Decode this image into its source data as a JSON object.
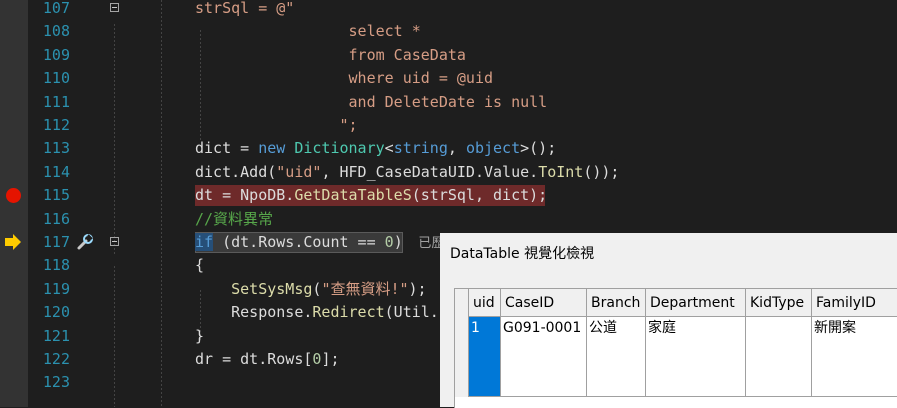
{
  "editor": {
    "lines": [
      {
        "num": "107",
        "tokens": [
          [
            "strSql = @\"",
            "s"
          ]
        ],
        "fold": true
      },
      {
        "num": "108",
        "tokens": [
          [
            "                 select *",
            "s"
          ]
        ]
      },
      {
        "num": "109",
        "tokens": [
          [
            "                 from CaseData",
            "s"
          ]
        ]
      },
      {
        "num": "110",
        "tokens": [
          [
            "                 where uid = @uid",
            "s"
          ]
        ]
      },
      {
        "num": "111",
        "tokens": [
          [
            "                 and DeleteDate is null",
            "s"
          ]
        ]
      },
      {
        "num": "112",
        "tokens": [
          [
            "                \";",
            "s"
          ]
        ]
      },
      {
        "num": "113",
        "tokens": [
          [
            "dict = ",
            ""
          ],
          [
            "new ",
            "k"
          ],
          [
            "Dictionary",
            "t"
          ],
          [
            "<",
            ""
          ],
          [
            "string",
            "k"
          ],
          [
            ", ",
            ""
          ],
          [
            "object",
            "k"
          ],
          [
            ">();",
            ""
          ]
        ]
      },
      {
        "num": "114",
        "tokens": [
          [
            "dict.Add(",
            ""
          ],
          [
            "\"uid\"",
            "s"
          ],
          [
            ", HFD_CaseDataUID.Value.",
            ""
          ],
          [
            "ToInt",
            "m"
          ],
          [
            "());",
            ""
          ]
        ]
      },
      {
        "num": "115",
        "tokens": [
          [
            "dt = NpoDB.",
            ""
          ],
          [
            "GetDataTableS",
            "m"
          ],
          [
            "(strSql, dict);",
            ""
          ]
        ],
        "breakpoint": true
      },
      {
        "num": "116",
        "tokens": [
          [
            "//資料異常",
            "c"
          ]
        ]
      },
      {
        "num": "117",
        "tokens": [
          [
            "if",
            "sel"
          ],
          [
            " (dt.Rows.Count == ",
            ""
          ],
          [
            "0",
            "n"
          ],
          [
            ")",
            ""
          ]
        ],
        "current": true,
        "fold": true,
        "hint": "已歷"
      },
      {
        "num": "118",
        "tokens": [
          [
            "{",
            ""
          ]
        ]
      },
      {
        "num": "119",
        "tokens": [
          [
            "    ",
            ""
          ],
          [
            "SetSysMsg",
            "m"
          ],
          [
            "(",
            ""
          ],
          [
            "\"查無資料!\"",
            "s"
          ],
          [
            ");",
            ""
          ]
        ]
      },
      {
        "num": "120",
        "tokens": [
          [
            "    Response.",
            ""
          ],
          [
            "Redirect",
            "m"
          ],
          [
            "(Util.I",
            ""
          ]
        ]
      },
      {
        "num": "121",
        "tokens": [
          [
            "}",
            ""
          ]
        ]
      },
      {
        "num": "122",
        "tokens": [
          [
            "dr = dt.Rows[",
            ""
          ],
          [
            "0",
            "n"
          ],
          [
            "];",
            ""
          ]
        ]
      },
      {
        "num": "123",
        "tokens": []
      }
    ]
  },
  "visualizer": {
    "title": "DataTable 視覺化檢視",
    "columns": [
      "uid",
      "CaseID",
      "Branch",
      "Department",
      "KidType",
      "FamilyID"
    ],
    "rows": [
      [
        "1",
        "G091-0001",
        "公道",
        "家庭",
        "",
        "新開案"
      ]
    ]
  },
  "colors": {
    "background": "#1e1e1e",
    "line_number": "#2b91af",
    "string": "#d69d85",
    "keyword": "#569cd6",
    "type": "#4ec9b0",
    "method": "#dcdcaa",
    "comment": "#57a64a",
    "breakpoint": "#e51400",
    "current_statement_arrow": "#ffcc00",
    "selection": "#0078d7"
  },
  "icons": {
    "breakpoint": "breakpoint-icon",
    "current_line": "current-statement-arrow-icon",
    "run_to_click": "wrench-icon",
    "collapse": "collapse-minus-icon"
  }
}
